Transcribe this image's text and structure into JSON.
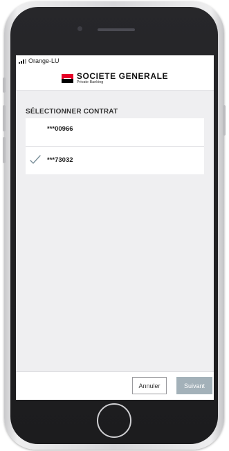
{
  "status_bar": {
    "carrier": "Orange-LU",
    "signal_icon": "signal-bars-icon"
  },
  "header": {
    "brand_name": "SOCIETE GENERALE",
    "brand_subtitle": "Private Banking",
    "brand_colors": {
      "red": "#e60028",
      "black": "#000000"
    }
  },
  "main": {
    "section_title": "SÉLECTIONNER CONTRAT",
    "contracts": [
      {
        "label": "***00966",
        "selected": false
      },
      {
        "label": "***73032",
        "selected": true
      }
    ],
    "check_icon": "checkmark-icon",
    "check_color": "#7a8f99"
  },
  "footer": {
    "cancel_label": "Annuler",
    "next_label": "Suivant",
    "next_color": "#a3b1b9"
  }
}
